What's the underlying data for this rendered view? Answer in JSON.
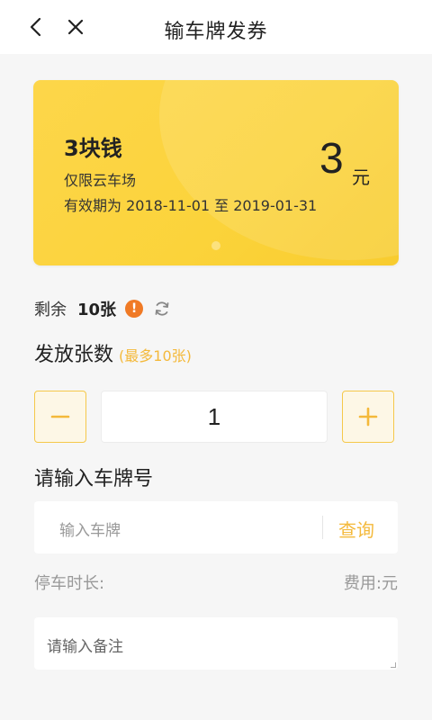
{
  "nav": {
    "title": "输车牌发券"
  },
  "coupon": {
    "name": "3块钱",
    "scope": "仅限云车场",
    "validity": "有效期为 2018-11-01 至 2019-01-31",
    "amount": "3",
    "unit": "元",
    "accent": "#fbd33a"
  },
  "remaining": {
    "label": "剩余",
    "count": "10张",
    "warn_glyph": "!"
  },
  "issue": {
    "label": "发放张数",
    "hint": "(最多10张)",
    "quantity": "1",
    "minus_glyph": "−",
    "plus_glyph": "+"
  },
  "plate": {
    "label": "请输入车牌号",
    "placeholder": "输入车牌",
    "query_label": "查询"
  },
  "info": {
    "duration": "停车时长:",
    "fee": "费用:元"
  },
  "remark": {
    "placeholder": "请输入备注"
  },
  "colors": {
    "accent_text": "#f4b93b",
    "warn": "#f07a25"
  }
}
